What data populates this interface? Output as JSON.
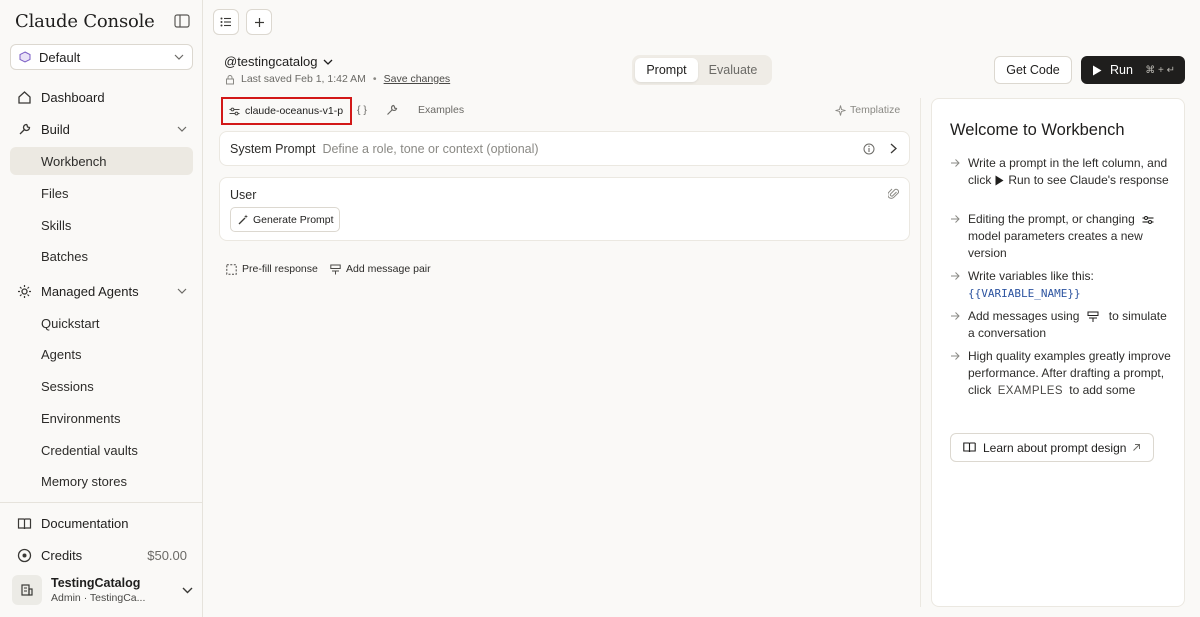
{
  "sidebar": {
    "brand": "Claude Console",
    "workspace": "Default",
    "dashboard": "Dashboard",
    "build": "Build",
    "build_items": [
      "Workbench",
      "Files",
      "Skills",
      "Batches"
    ],
    "managed_agents": "Managed Agents",
    "agent_items": [
      "Quickstart",
      "Agents",
      "Sessions",
      "Environments",
      "Credential vaults",
      "Memory stores"
    ],
    "documentation": "Documentation",
    "credits": "Credits",
    "credits_amount": "$50.00",
    "user_name": "TestingCatalog",
    "user_role": "Admin",
    "user_sep": "·",
    "user_org": "TestingCa..."
  },
  "header": {
    "prompt_name": "@testingcatalog",
    "last_saved": "Last saved Feb 1, 1:42 AM",
    "dot": "•",
    "save_changes": "Save changes",
    "tab_prompt": "Prompt",
    "tab_evaluate": "Evaluate",
    "get_code": "Get Code",
    "run": "Run",
    "run_shortcut": "⌘ + ↵"
  },
  "toolbar": {
    "model": "claude-oceanus-v1-p",
    "variables": "{ }",
    "examples": "Examples",
    "templatize": "Templatize"
  },
  "editor": {
    "system_label": "System Prompt",
    "system_placeholder": "Define a role, tone or context (optional)",
    "user_label": "User",
    "generate_prompt": "Generate Prompt",
    "prefill": "Pre-fill response",
    "add_pair": "Add message pair"
  },
  "welcome": {
    "title": "Welcome to Workbench",
    "tip1_a": "Write a prompt in the left column, and click",
    "tip1_b": "Run to see Claude's response",
    "tip2_a": "Editing the prompt, or changing",
    "tip2_b": "model parameters creates a new version",
    "tip3_a": "Write variables like this:",
    "tip3_b": "{{VARIABLE_NAME}}",
    "tip4_a": "Add messages using",
    "tip4_b": "to simulate a conversation",
    "tip5_a": "High quality examples greatly improve performance. After drafting a prompt, click",
    "tip5_b": "EXAMPLES",
    "tip5_c": "to add some",
    "learn": "Learn about prompt design"
  },
  "colors": {
    "accent_dark": "#1f1e1d",
    "highlight_border": "#d21818",
    "variable_blue": "#2d54a0",
    "background": "#faf9f7"
  }
}
